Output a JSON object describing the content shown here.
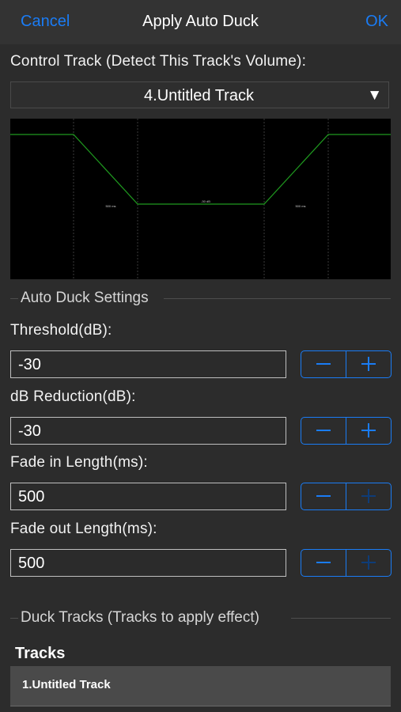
{
  "nav": {
    "cancel": "Cancel",
    "title": "Apply Auto Duck",
    "ok": "OK"
  },
  "control": {
    "label": "Control Track (Detect This Track's Volume):",
    "selected": "4.Untitled Track",
    "arrow_icon": "▼"
  },
  "graph": {
    "fade_in_label": "500 ms",
    "reduction_label": "-30 dB",
    "fade_out_label": "500 ms",
    "line_color": "#1f9a1f"
  },
  "settings": {
    "header": "Auto Duck Settings",
    "fields": [
      {
        "label": "Threshold(dB):",
        "value": "-30",
        "plus_enabled": true
      },
      {
        "label": "dB Reduction(dB):",
        "value": "-30",
        "plus_enabled": true
      },
      {
        "label": "Fade in Length(ms):",
        "value": "500",
        "plus_enabled": false
      },
      {
        "label": "Fade out Length(ms):",
        "value": "500",
        "plus_enabled": false
      }
    ]
  },
  "duck": {
    "header": "Duck Tracks (Tracks to apply effect)",
    "tracks_title": "Tracks",
    "tracks": [
      "1.Untitled Track"
    ]
  },
  "colors": {
    "accent": "#1a7cf5",
    "background": "#2c2c2c",
    "nav": "#333333"
  }
}
